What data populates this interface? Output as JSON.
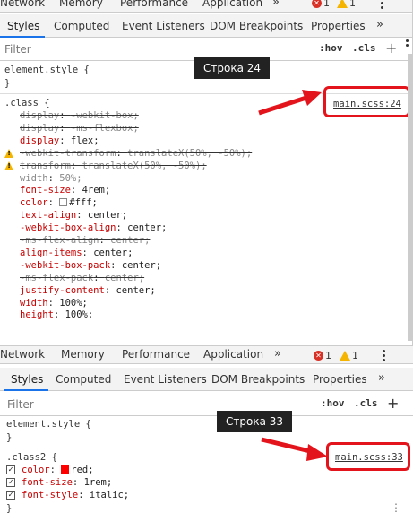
{
  "top_tabs_1": [
    "Network",
    "Memory",
    "Performance",
    "Application"
  ],
  "top_tabs_2": [
    "Network",
    "Memory",
    "Performance",
    "Application"
  ],
  "more_chevron": "»",
  "error_count": "1",
  "warning_count": "1",
  "sub_tabs": [
    "Styles",
    "Computed",
    "Event Listeners",
    "DOM Breakpoints",
    "Properties"
  ],
  "filter": {
    "placeholder": "Filter",
    "hov": ":hov",
    "cls": ".cls",
    "add": "+"
  },
  "element_style": {
    "selector": "element.style {",
    "close": "}"
  },
  "panel1": {
    "selector": ".class {",
    "source": "main.scss:24",
    "annotation": "Строка 24",
    "declarations": [
      {
        "prop": "display",
        "value": "-webkit-box;",
        "struck": true,
        "warn": false
      },
      {
        "prop": "display",
        "value": "-ms-flexbox;",
        "struck": true,
        "warn": false
      },
      {
        "prop": "display",
        "value": "flex;",
        "struck": false,
        "warn": false
      },
      {
        "prop": "-webkit-transform",
        "value": "translateX(50%, -50%);",
        "struck": true,
        "warn": true
      },
      {
        "prop": "transform",
        "value": "translateX(50%, -50%);",
        "struck": true,
        "warn": true
      },
      {
        "prop": "width",
        "value": "50%;",
        "struck": true,
        "warn": false
      },
      {
        "prop": "font-size",
        "value": "4rem;",
        "struck": false,
        "warn": false
      },
      {
        "prop": "color",
        "value": "#fff;",
        "struck": false,
        "warn": false,
        "swatch": "#ffffff"
      },
      {
        "prop": "text-align",
        "value": "center;",
        "struck": false,
        "warn": false
      },
      {
        "prop": "-webkit-box-align",
        "value": "center;",
        "struck": false,
        "warn": false
      },
      {
        "prop": "-ms-flex-align",
        "value": "center;",
        "struck": true,
        "warn": false
      },
      {
        "prop": "align-items",
        "value": "center;",
        "struck": false,
        "warn": false
      },
      {
        "prop": "-webkit-box-pack",
        "value": "center;",
        "struck": false,
        "warn": false
      },
      {
        "prop": "-ms-flex-pack",
        "value": "center;",
        "struck": true,
        "warn": false
      },
      {
        "prop": "justify-content",
        "value": "center;",
        "struck": false,
        "warn": false
      },
      {
        "prop": "width",
        "value": "100%;",
        "struck": false,
        "warn": false
      },
      {
        "prop": "height",
        "value": "100%;",
        "struck": false,
        "warn": false
      }
    ]
  },
  "panel2": {
    "selector": ".class2 {",
    "source": "main.scss:33",
    "annotation": "Строка 33",
    "declarations": [
      {
        "prop": "color",
        "value": "red;",
        "swatch": "#ff0000"
      },
      {
        "prop": "font-size",
        "value": "1rem;"
      },
      {
        "prop": "font-style",
        "value": "italic;"
      }
    ],
    "close": "}"
  },
  "colors": {
    "accent": "#1a73e8",
    "annotation_red": "#e3141b",
    "property": "#c80000"
  }
}
